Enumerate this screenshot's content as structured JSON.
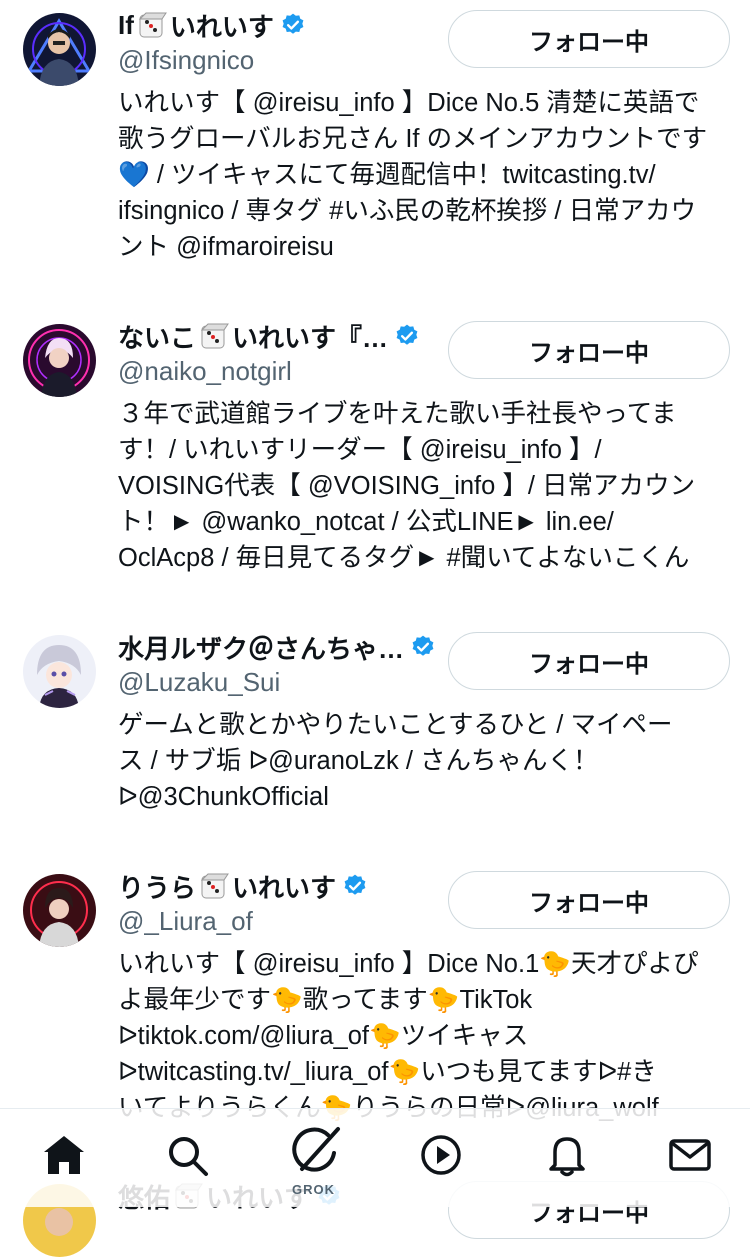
{
  "users": [
    {
      "name_before": "If",
      "name_after": "いれいす",
      "handle": "@Ifsingnico",
      "follow_label": "フォロー中",
      "bio": "いれいす【 @ireisu_info 】Dice No.5 清楚に英語で\n歌うグローバルお兄さん If のメインアカウントです\n💙 / ツイキャスにて毎週配信中！twitcasting.tv/\nifsingnico / 専タグ #いふ民の乾杯挨拶 / 日常アカウ\nント @ifmaroireisu"
    },
    {
      "name_before": "ないこ",
      "name_after": "いれいす『…",
      "handle": "@naiko_notgirl",
      "follow_label": "フォロー中",
      "bio": "３年で武道館ライブを叶えた歌い手社長やってま\nす！/ いれいすリーダー【 @ireisu_info 】/\nVOISING代表【 @VOISING_info 】/ 日常アカウン\nト！► @wanko_notcat / 公式LINE► lin.ee/\nOclAcp8 / 毎日見てるタグ► #聞いてよないこくん"
    },
    {
      "name_before": "水月ルザク＠さんちゃ…",
      "name_after": "",
      "handle": "@Luzaku_Sui",
      "follow_label": "フォロー中",
      "bio": "ゲームと歌とかやりたいことするひと / マイペー\nス / サブ垢 ᐅ@uranoLzk / さんちゃんく！\nᐅ@3ChunkOfficial"
    },
    {
      "name_before": "りうら",
      "name_after": "いれいす",
      "handle": "@_Liura_of",
      "follow_label": "フォロー中",
      "bio": "いれいす【 @ireisu_info 】Dice No.1🐤天才ぴよぴ\nよ最年少です🐤歌ってます🐤TikTok\nᐅtiktok.com/@liura_of🐤ツイキャス\nᐅtwitcasting.tv/_liura_of🐤いつも見てますᐅ#き\nいてよりうらくん🐤りうらの日常ᐅ@liura_wolf"
    },
    {
      "name_before": "悠佑",
      "name_after": "いれいす",
      "handle": "",
      "follow_label": "フォロー中",
      "bio": ""
    }
  ],
  "tabbar": {
    "grok_label": "GROK"
  },
  "colors": {
    "verified": "#1d9bf0",
    "text_primary": "#0f1419",
    "text_secondary": "#536471",
    "button_border": "#cfd9de"
  }
}
